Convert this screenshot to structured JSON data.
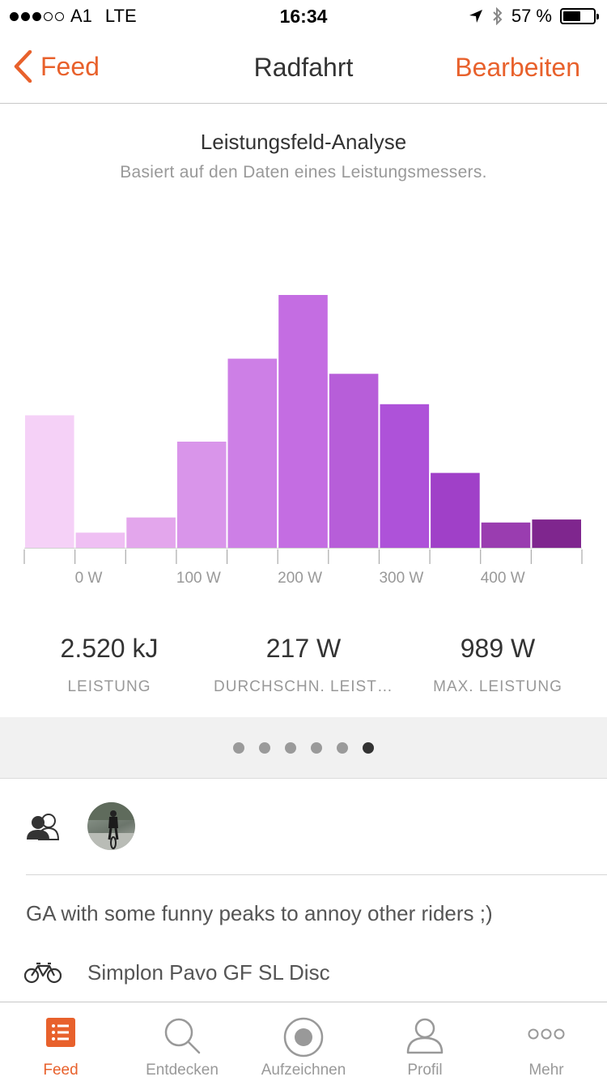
{
  "status_bar": {
    "carrier": "A1",
    "network": "LTE",
    "time": "16:34",
    "battery_percent": "57 %",
    "battery_level": 0.57,
    "signal_bars": 3
  },
  "nav": {
    "back_label": "Feed",
    "title": "Radfahrt",
    "edit_label": "Bearbeiten",
    "accent_color": "#e8612c"
  },
  "chart_data": {
    "type": "bar",
    "title": "Leistungsfeld-Analyse",
    "subtitle": "Basiert auf den Daten eines Leistungsmessers.",
    "categories": [
      "<0",
      "0-50",
      "50-100",
      "100-150",
      "150-200",
      "200-250",
      "250-300",
      "300-350",
      "350-400",
      "400-450",
      "450+"
    ],
    "values": [
      13.1,
      1.5,
      3.0,
      10.5,
      18.7,
      25.0,
      17.2,
      14.2,
      7.4,
      2.5,
      2.8
    ],
    "bar_colors": [
      "#f5d1f7",
      "#efbff3",
      "#e3a6ec",
      "#d995ea",
      "#cd7fe6",
      "#c46de2",
      "#b75ed9",
      "#ae52d9",
      "#a040c8",
      "#9a3db0",
      "#7f268e"
    ],
    "tick_labels": [
      "0 W",
      "100 W",
      "200 W",
      "300 W",
      "400 W"
    ],
    "grid": false,
    "legend": "none"
  },
  "stats": [
    {
      "value": "2.520 kJ",
      "label": "LEISTUNG"
    },
    {
      "value": "217 W",
      "label": "DURCHSCHN. LEISTUNG"
    },
    {
      "value": "989 W",
      "label": "MAX. LEISTUNG"
    }
  ],
  "pager": {
    "count": 6,
    "active_index": 5
  },
  "activity": {
    "description": "GA with some funny peaks to annoy other riders ;)",
    "bike": "Simplon Pavo GF SL Disc"
  },
  "tabs": [
    {
      "label": "Feed",
      "icon": "feed-list-icon",
      "active": true
    },
    {
      "label": "Entdecken",
      "icon": "search-icon",
      "active": false
    },
    {
      "label": "Aufzeichnen",
      "icon": "record-icon",
      "active": false
    },
    {
      "label": "Profil",
      "icon": "profile-icon",
      "active": false
    },
    {
      "label": "Mehr",
      "icon": "more-dots-icon",
      "active": false
    }
  ]
}
